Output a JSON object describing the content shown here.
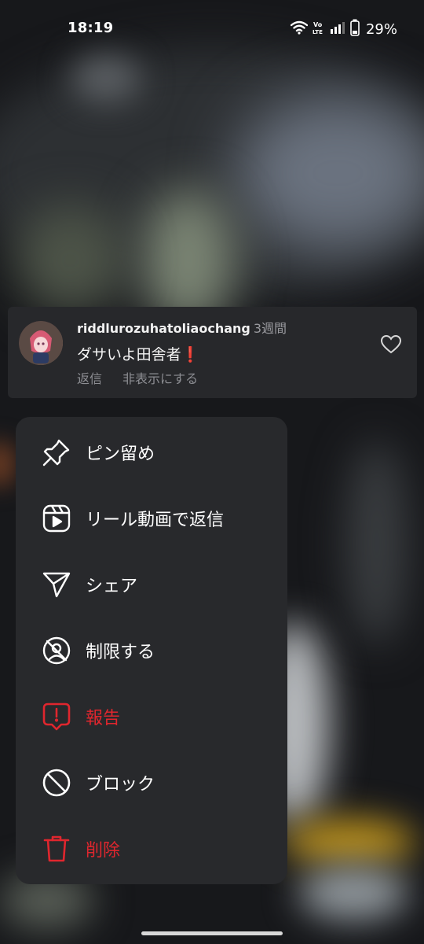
{
  "status_bar": {
    "time": "18:19",
    "battery": "29%",
    "icons": [
      "wifi-icon",
      "volte-icon",
      "signal-icon",
      "battery-icon"
    ]
  },
  "comment": {
    "username": "riddlurozuhatoliaochang",
    "time": "3週間",
    "text": "ダサいよ田舎者❗",
    "reply_label": "返信",
    "hide_label": "非表示にする"
  },
  "menu": {
    "items": [
      {
        "label": "ピン留め",
        "icon": "pin-icon",
        "danger": false
      },
      {
        "label": "リール動画で返信",
        "icon": "reel-icon",
        "danger": false
      },
      {
        "label": "シェア",
        "icon": "send-icon",
        "danger": false
      },
      {
        "label": "制限する",
        "icon": "restrict-icon",
        "danger": false
      },
      {
        "label": "報告",
        "icon": "report-icon",
        "danger": true
      },
      {
        "label": "ブロック",
        "icon": "block-icon",
        "danger": false
      },
      {
        "label": "削除",
        "icon": "trash-icon",
        "danger": true
      }
    ]
  },
  "colors": {
    "danger": "#e0262e",
    "menu_bg": "#28292c",
    "card_bg": "#27282b"
  }
}
